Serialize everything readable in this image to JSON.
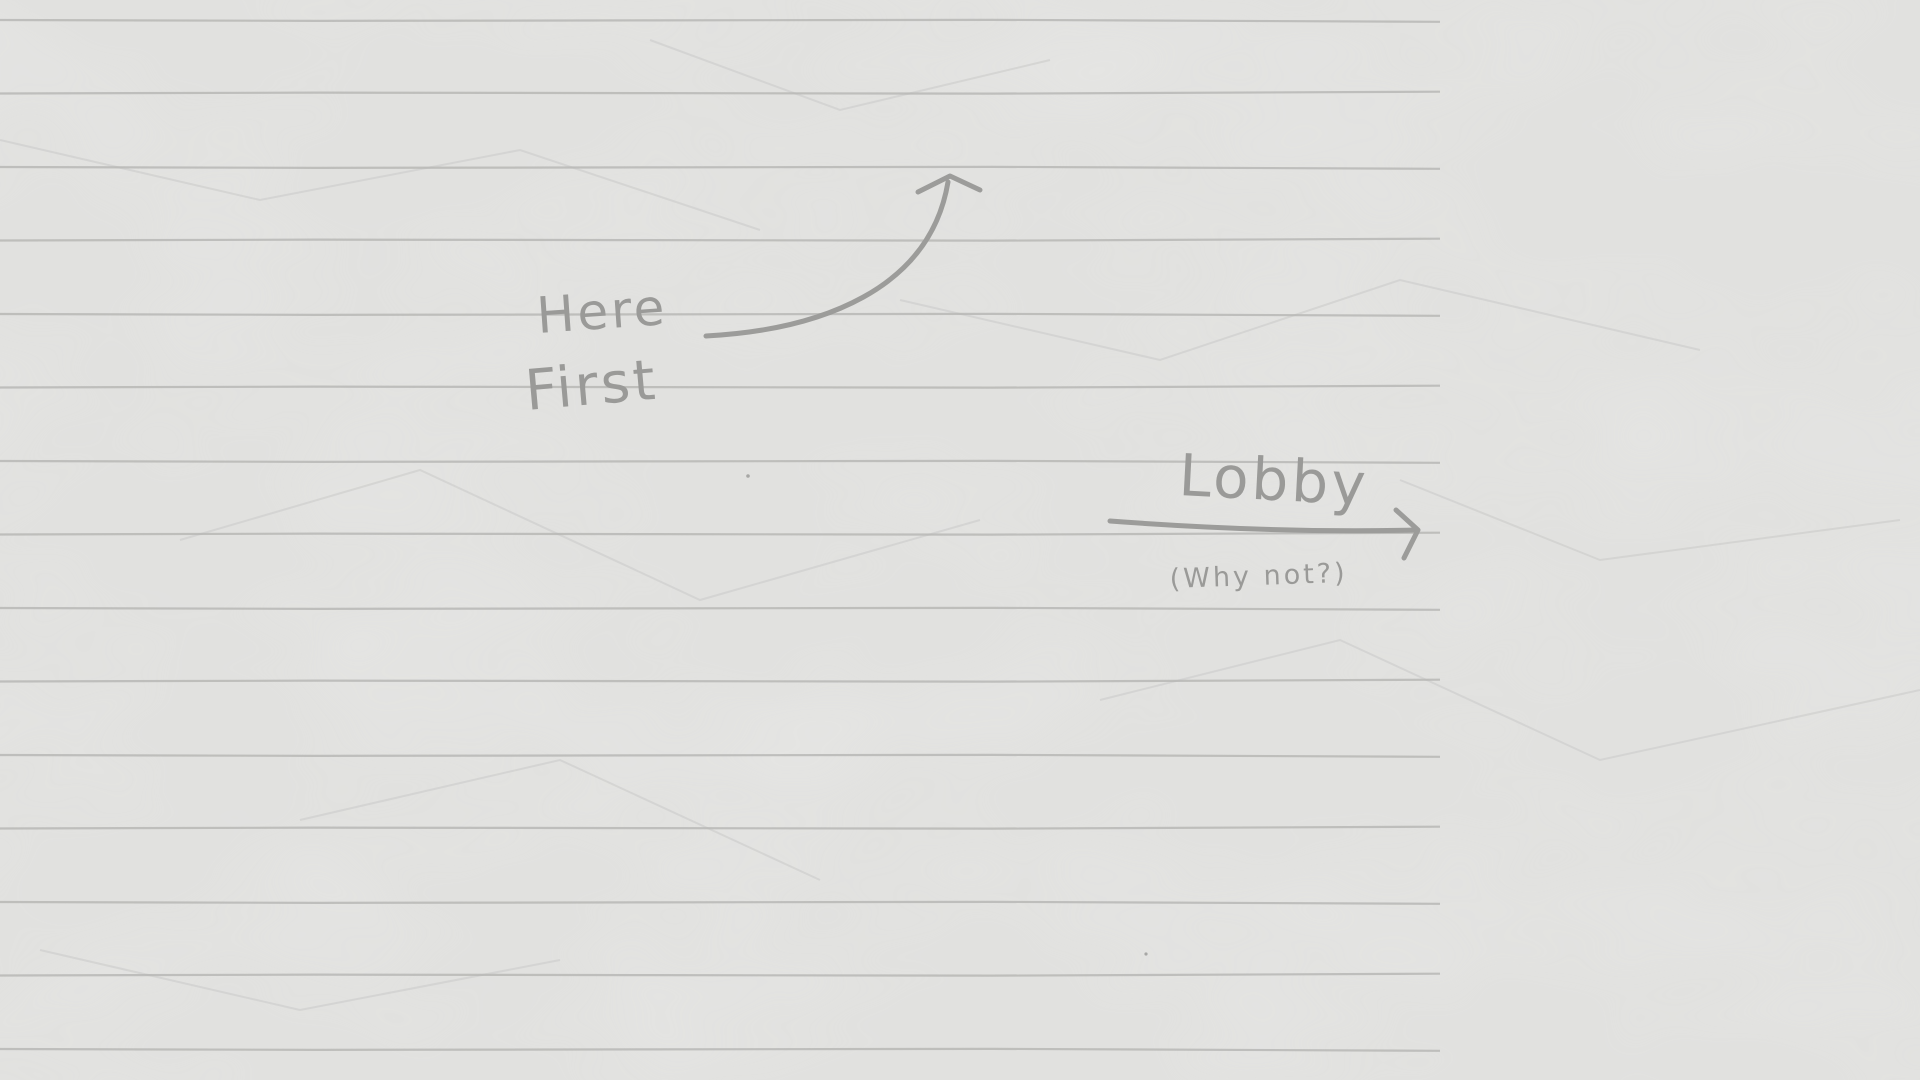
{
  "colors": {
    "paper": "#e1e1df",
    "ruled_line": "#b7b7b5",
    "pencil": "#9a9a98"
  },
  "annotations": {
    "here_first": {
      "line1": "Here",
      "line2": "First",
      "arrow_icon": "curved-arrow-up-icon"
    },
    "lobby": {
      "label": "Lobby",
      "note": "(Why not?)",
      "arrow_icon": "arrow-right-icon"
    }
  }
}
